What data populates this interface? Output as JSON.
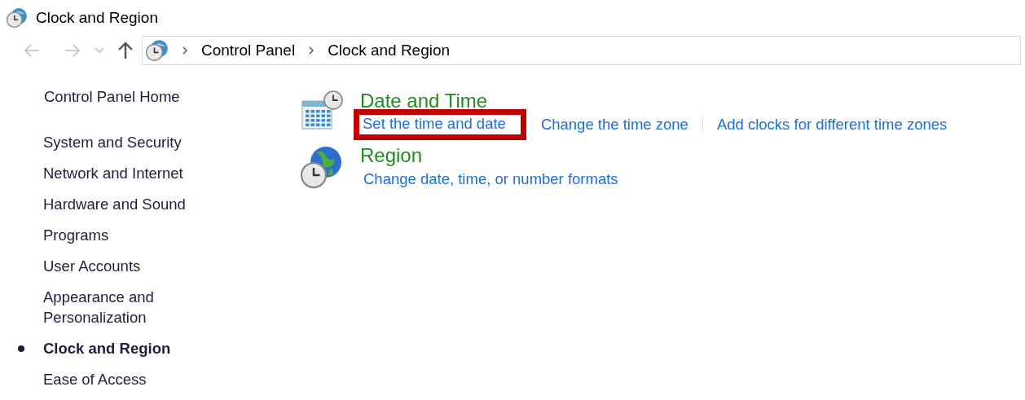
{
  "window": {
    "title": "Clock and Region"
  },
  "navigation": {
    "back_enabled": false,
    "forward_enabled": false,
    "breadcrumb": [
      "Control Panel",
      "Clock and Region"
    ]
  },
  "sidebar": {
    "home": "Control Panel Home",
    "items": [
      {
        "label": "System and Security",
        "selected": false
      },
      {
        "label": "Network and Internet",
        "selected": false
      },
      {
        "label": "Hardware and Sound",
        "selected": false
      },
      {
        "label": "Programs",
        "selected": false
      },
      {
        "label": "User Accounts",
        "selected": false
      },
      {
        "label": "Appearance and Personalization",
        "selected": false
      },
      {
        "label": "Clock and Region",
        "selected": true
      },
      {
        "label": "Ease of Access",
        "selected": false
      }
    ]
  },
  "categories": [
    {
      "kind": "datetime",
      "title": "Date and Time",
      "tasks": [
        {
          "label": "Set the time and date",
          "highlighted": true
        },
        {
          "label": "Change the time zone",
          "highlighted": false
        },
        {
          "label": "Add clocks for different time zones",
          "highlighted": false
        }
      ]
    },
    {
      "kind": "region",
      "title": "Region",
      "tasks": [
        {
          "label": "Change date, time, or number formats",
          "highlighted": false
        }
      ]
    }
  ]
}
